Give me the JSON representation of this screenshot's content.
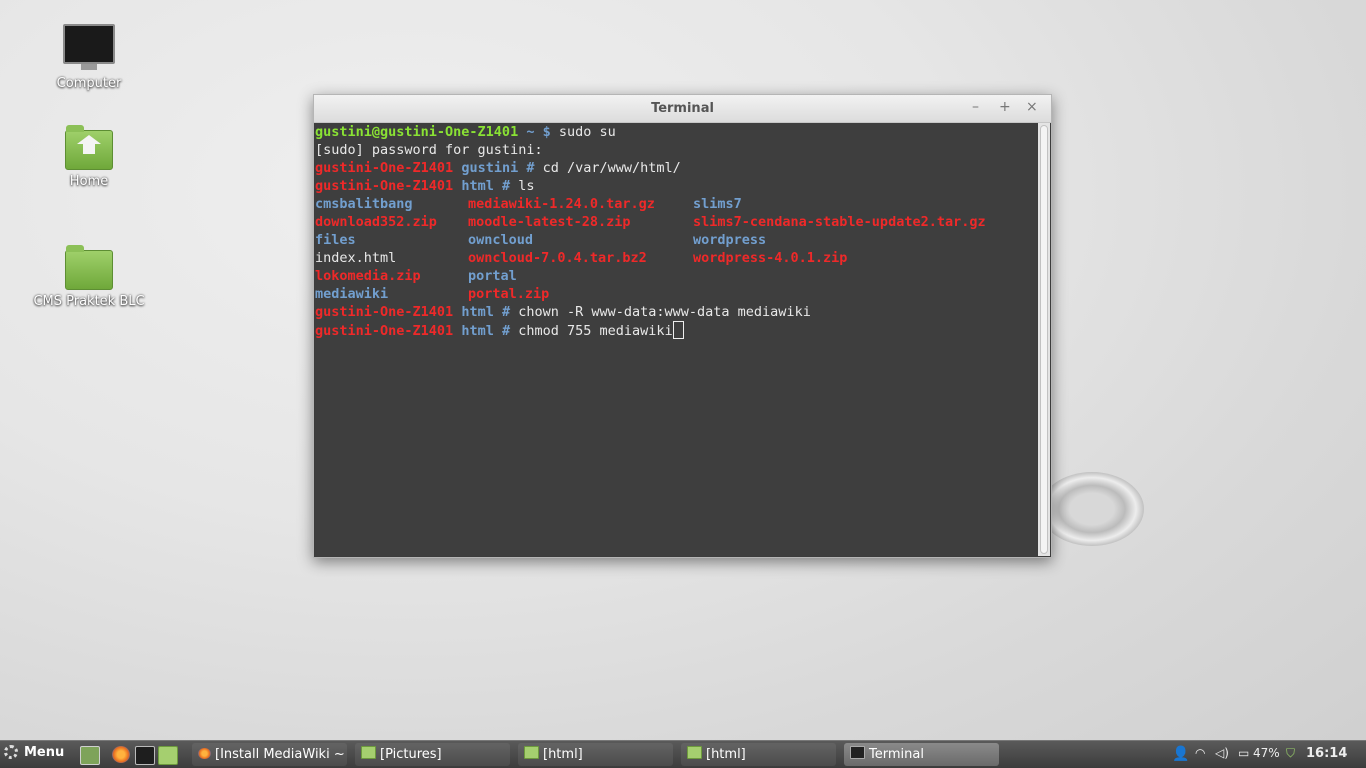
{
  "desktop": {
    "icons": [
      {
        "label": "Computer"
      },
      {
        "label": "Home"
      },
      {
        "label": "CMS Praktek BLC"
      }
    ]
  },
  "terminal_window": {
    "title": "Terminal",
    "controls": {
      "minimize": "–",
      "maximize": "+",
      "close": "×"
    },
    "prompt_user": "gustini@gustini-One-Z1401",
    "root_host": "gustini-One-Z1401",
    "lines": {
      "l1_path": "~ $",
      "l1_cmd": " sudo su",
      "l2": "[sudo] password for gustini:",
      "l3_path": "gustini #",
      "l3_cmd": " cd /var/www/html/",
      "l4_path": "html #",
      "l4_cmd": " ls",
      "l11_path": "html #",
      "l11_cmd": " chown -R www-data:www-data mediawiki",
      "l12_path": "html #",
      "l12_cmd": " chmod 755 mediawiki"
    },
    "ls_output": [
      [
        {
          "name": "cmsbalitbang",
          "kind": "dir"
        },
        {
          "name": "mediawiki-1.24.0.tar.gz",
          "kind": "arch"
        },
        {
          "name": "slims7",
          "kind": "dir"
        }
      ],
      [
        {
          "name": "download352.zip",
          "kind": "arch"
        },
        {
          "name": "moodle-latest-28.zip",
          "kind": "arch"
        },
        {
          "name": "slims7-cendana-stable-update2.tar.gz",
          "kind": "arch"
        }
      ],
      [
        {
          "name": "files",
          "kind": "dir"
        },
        {
          "name": "owncloud",
          "kind": "dir"
        },
        {
          "name": "wordpress",
          "kind": "dir"
        }
      ],
      [
        {
          "name": "index.html",
          "kind": "file"
        },
        {
          "name": "owncloud-7.0.4.tar.bz2",
          "kind": "arch"
        },
        {
          "name": "wordpress-4.0.1.zip",
          "kind": "arch"
        }
      ],
      [
        {
          "name": "lokomedia.zip",
          "kind": "arch"
        },
        {
          "name": "portal",
          "kind": "dir"
        },
        {
          "name": "",
          "kind": "file"
        }
      ],
      [
        {
          "name": "mediawiki",
          "kind": "dir"
        },
        {
          "name": "portal.zip",
          "kind": "arch"
        },
        {
          "name": "",
          "kind": "file"
        }
      ]
    ]
  },
  "taskbar": {
    "menu_label": "Menu",
    "tasks": [
      {
        "label": "[Install MediaWiki ~ ...",
        "icon": "firefox-icon"
      },
      {
        "label": "[Pictures]",
        "icon": "folder-icon"
      },
      {
        "label": "[html]",
        "icon": "folder-icon"
      },
      {
        "label": "[html]",
        "icon": "folder-icon"
      },
      {
        "label": "Terminal",
        "icon": "terminal-icon"
      }
    ],
    "battery": "47%",
    "clock": "16:14"
  },
  "colors": {
    "prompt_user": "#8ae234",
    "prompt_root": "#ef2929",
    "dir": "#729fcf",
    "archive": "#ef2929"
  }
}
